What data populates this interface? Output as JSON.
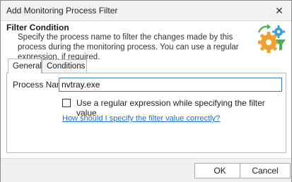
{
  "window": {
    "title": "Add Monitoring Process Filter",
    "close_glyph": "✕"
  },
  "header": {
    "title": "Filter Condition",
    "description": "Specify the process name to filter the changes made by this process during the monitoring process. You can use a regular expression, if required.",
    "icon": "filter-gears-icon"
  },
  "tabs": [
    {
      "label": "General",
      "active": true
    },
    {
      "label": "Conditions",
      "active": false
    }
  ],
  "general": {
    "process_name_label": "Process Name:",
    "process_name_value": "nvtray.exe",
    "use_regex_label": "Use a regular expression while specifying the filter value",
    "use_regex_checked": false,
    "help_link": "How should I specify the filter value correctly?"
  },
  "buttons": {
    "ok": "OK",
    "cancel": "Cancel"
  },
  "colors": {
    "link": "#1a6fcf",
    "input_border": "#3c7fb1",
    "icon_orange": "#f0a030",
    "icon_blue": "#3aa0dc",
    "icon_green": "#4caf50"
  }
}
